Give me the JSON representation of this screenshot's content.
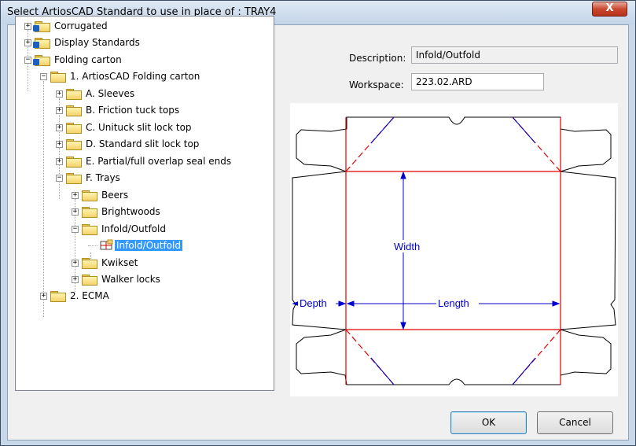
{
  "window": {
    "title": "Select ArtiosCAD Standard to use in place of : TRAY4",
    "close_glyph": "X"
  },
  "tree": {
    "expand_glyph": "+",
    "collapse_glyph": "−",
    "nodes": [
      {
        "id": "corrugated",
        "label": "Corrugated",
        "expander": "+",
        "kind": "net-folder"
      },
      {
        "id": "display",
        "label": "Display Standards",
        "expander": "+",
        "kind": "net-folder"
      },
      {
        "id": "folding",
        "label": "Folding carton",
        "expander": "−",
        "kind": "net-folder"
      },
      {
        "id": "artios",
        "label": "1. ArtiosCAD Folding carton",
        "expander": "−",
        "kind": "folder"
      },
      {
        "id": "sleeves",
        "label": "A. Sleeves",
        "expander": "+",
        "kind": "folder"
      },
      {
        "id": "friction",
        "label": "B. Friction tuck tops",
        "expander": "+",
        "kind": "folder"
      },
      {
        "id": "unituck",
        "label": "C. Unituck slit lock top",
        "expander": "+",
        "kind": "folder"
      },
      {
        "id": "standard",
        "label": "D. Standard slit lock top",
        "expander": "+",
        "kind": "folder"
      },
      {
        "id": "partial",
        "label": "E. Partial/full overlap seal ends",
        "expander": "+",
        "kind": "folder"
      },
      {
        "id": "trays",
        "label": "F. Trays",
        "expander": "−",
        "kind": "folder"
      },
      {
        "id": "beers",
        "label": "Beers",
        "expander": "+",
        "kind": "folder"
      },
      {
        "id": "brightwoods",
        "label": "Brightwoods",
        "expander": "+",
        "kind": "folder"
      },
      {
        "id": "infold",
        "label": "Infold/Outfold",
        "expander": "−",
        "kind": "folder"
      },
      {
        "id": "infold-item",
        "label": "Infold/Outfold",
        "expander": "",
        "kind": "standard",
        "selected": true
      },
      {
        "id": "kwikset",
        "label": "Kwikset",
        "expander": "+",
        "kind": "folder"
      },
      {
        "id": "walker",
        "label": "Walker locks",
        "expander": "+",
        "kind": "folder"
      },
      {
        "id": "ecma",
        "label": "2. ECMA",
        "expander": "+",
        "kind": "folder"
      }
    ]
  },
  "fields": {
    "description_label": "Description:",
    "description_value": "Infold/Outfold",
    "workspace_label": "Workspace:",
    "workspace_value": "223.02.ARD"
  },
  "preview": {
    "width_label": "Width",
    "depth_label": "Depth",
    "length_label": "Length",
    "colors": {
      "cut": "#000000",
      "crease": "#e00000",
      "dimension": "#0000cc"
    }
  },
  "buttons": {
    "ok": "OK",
    "cancel": "Cancel"
  }
}
